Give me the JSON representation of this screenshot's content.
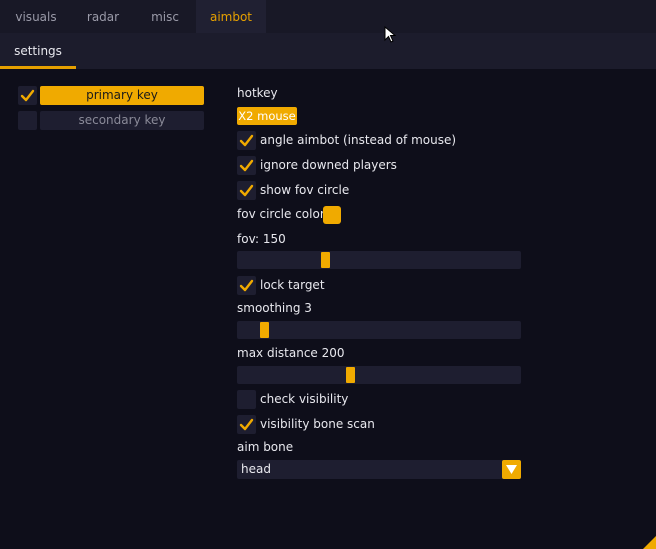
{
  "tabs": [
    {
      "label": "visuals",
      "active": false
    },
    {
      "label": "radar",
      "active": false
    },
    {
      "label": "misc",
      "active": false
    },
    {
      "label": "aimbot",
      "active": true
    }
  ],
  "subtab": {
    "label": "settings"
  },
  "keys": {
    "primary": {
      "label": "primary key",
      "checked": true
    },
    "secondary": {
      "label": "secondary key",
      "checked": false
    }
  },
  "settings": {
    "hotkey_label": "hotkey",
    "hotkey_value": "X2 mouse",
    "angle_aimbot": {
      "label": "angle aimbot (instead of mouse)",
      "checked": true
    },
    "ignore_downed": {
      "label": "ignore downed players",
      "checked": true
    },
    "show_fov_circle": {
      "label": "show fov circle",
      "checked": true
    },
    "fov_circle_color_label": "fov circle color:",
    "fov_circle_color": "#f0aa00",
    "fov": {
      "label": "fov: 150",
      "value": 150,
      "fraction": 0.305
    },
    "lock_target": {
      "label": "lock target",
      "checked": true
    },
    "smoothing": {
      "label": "smoothing 3",
      "value": 3,
      "fraction": 0.085
    },
    "max_distance": {
      "label": "max distance 200",
      "value": 200,
      "fraction": 0.395
    },
    "check_visibility": {
      "label": "check visibility",
      "checked": false
    },
    "visibility_bone_scan": {
      "label": "visibility bone scan",
      "checked": true
    },
    "aim_bone": {
      "label": "aim bone",
      "value": "head"
    }
  },
  "colors": {
    "accent": "#f0aa00",
    "background": "#0e0e1a",
    "control": "#1e1e30"
  }
}
